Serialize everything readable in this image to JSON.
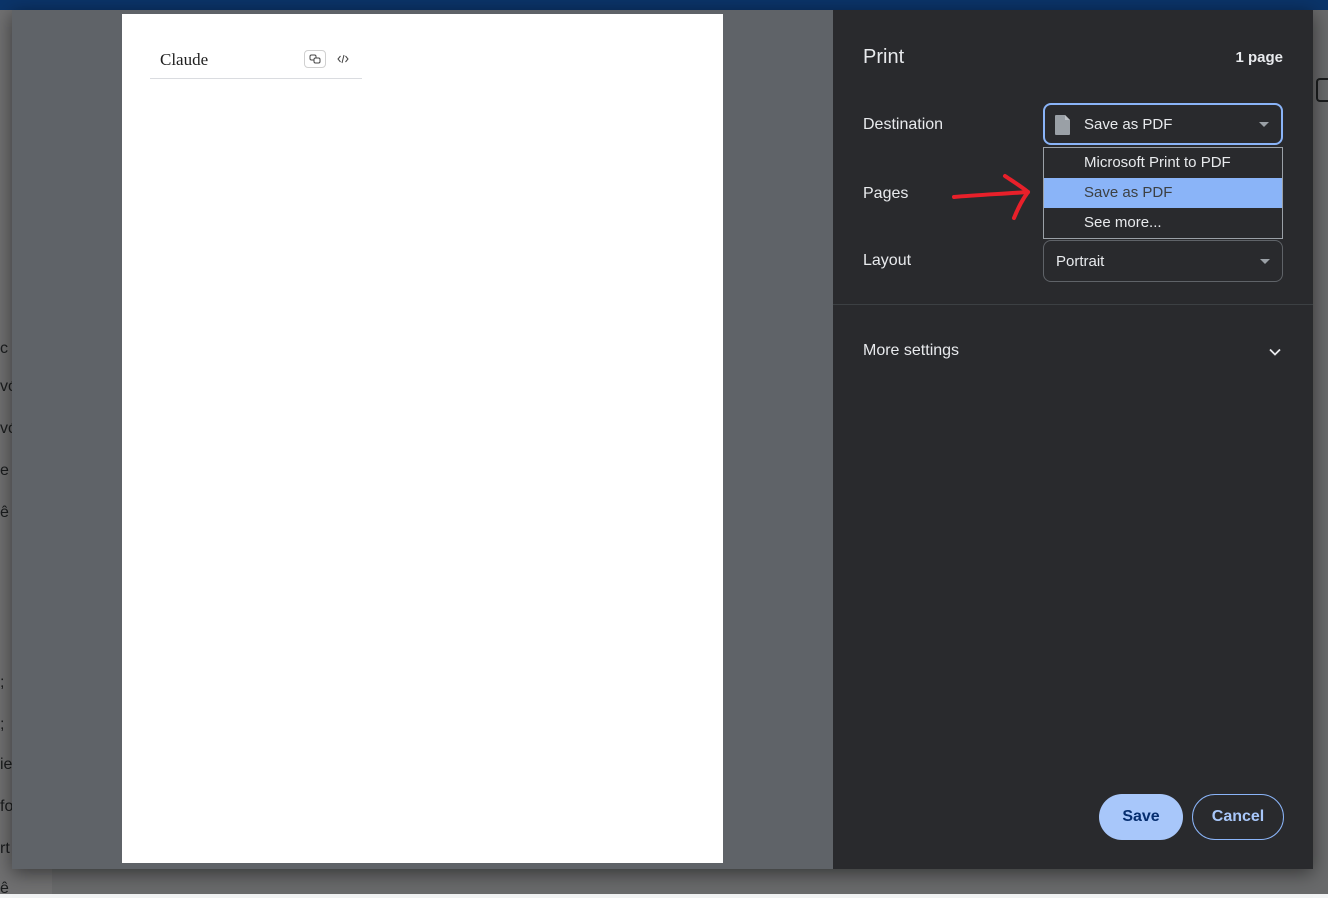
{
  "print_dialog": {
    "title": "Print",
    "page_count": "1 page",
    "destination": {
      "label": "Destination",
      "value": "Save as PDF",
      "options": [
        "Microsoft Print to PDF",
        "Save as PDF",
        "See more..."
      ],
      "highlighted_option": "Save as PDF"
    },
    "pages": {
      "label": "Pages"
    },
    "layout": {
      "label": "Layout",
      "value": "Portrait"
    },
    "more_settings": {
      "label": "More settings"
    },
    "buttons": {
      "save": "Save",
      "cancel": "Cancel"
    }
  },
  "preview": {
    "header_title": "Claude"
  },
  "background_fragments": [
    "c",
    "vớ",
    "vớ",
    "e",
    "ê",
    ";",
    ";",
    "ie",
    "fo",
    "rt",
    "ê th"
  ],
  "colors": {
    "panel_bg": "#292a2d",
    "preview_bg": "#5f6368",
    "accent": "#8ab4f8",
    "save_button": "#a8c7fa",
    "annotation_arrow": "#e8202a"
  },
  "icons": {
    "destination": "file-icon",
    "dropdown": "caret-down-icon",
    "more_settings": "chevron-down-icon",
    "annotation": "red-arrow-annotation"
  }
}
